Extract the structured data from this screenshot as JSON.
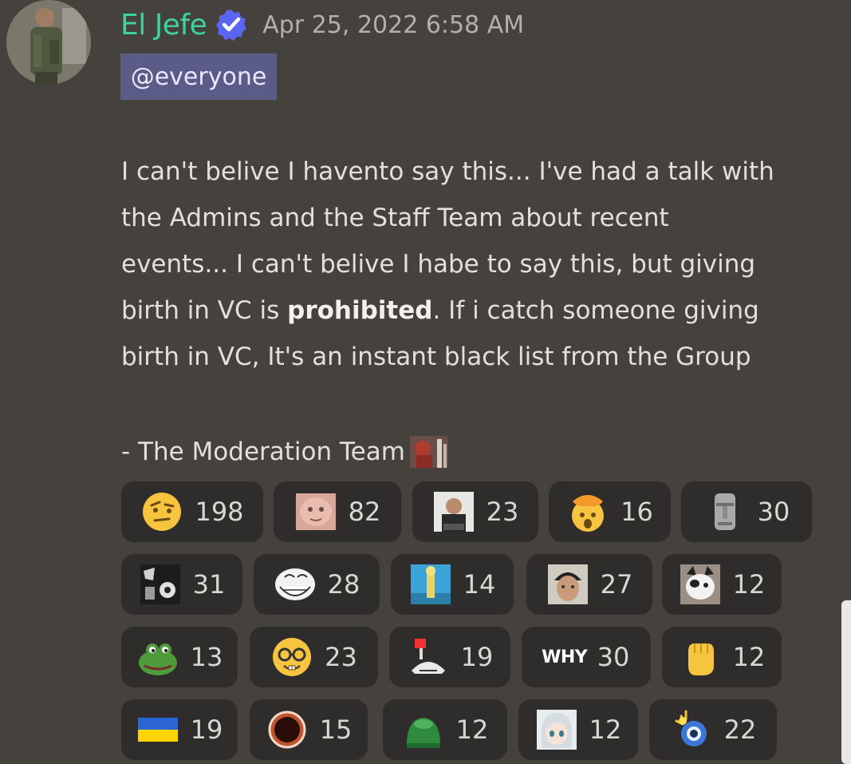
{
  "message": {
    "author": "El Jefe",
    "timestamp": "Apr 25, 2022 6:58 AM",
    "mention": "@everyone",
    "body_lines": [
      "I can't belive I havento say this... I've had a talk with",
      "the Admins and the Staff Team about recent",
      "events... I can't belive I habe to say this, but giving"
    ],
    "line4_before": "birth in VC is ",
    "line4_bold": "prohibited",
    "line4_after": ". If i catch someone giving",
    "line5": "birth in VC, It's an instant black list from the Group",
    "signature": "- The Moderation Team"
  },
  "icons": {
    "avatar": "avatar-soldier",
    "verified": "verified-check-icon",
    "signature_emoji": "custom-emoji-icon"
  },
  "colors": {
    "username": "#3fd29a",
    "mention_bg": "#5a5b86",
    "reaction_bg": "#2f2d2b",
    "background": "#45413d"
  },
  "reactions": [
    {
      "emoji": "raised-eyebrow-emoji",
      "count": "198"
    },
    {
      "emoji": "custom-face-emoji",
      "count": "82"
    },
    {
      "emoji": "custom-man-photo-emoji",
      "count": "23"
    },
    {
      "emoji": "exploding-head-emoji",
      "count": "16"
    },
    {
      "emoji": "moai-emoji",
      "count": "30"
    },
    {
      "emoji": "custom-bw-emoji",
      "count": "31"
    },
    {
      "emoji": "trollface-emoji",
      "count": "28"
    },
    {
      "emoji": "custom-cartoon-emoji",
      "count": "14"
    },
    {
      "emoji": "custom-beanie-emoji",
      "count": "27"
    },
    {
      "emoji": "custom-cat-emoji",
      "count": "12"
    },
    {
      "emoji": "pepe-frog-emoji",
      "count": "13"
    },
    {
      "emoji": "nerd-face-emoji",
      "count": "23"
    },
    {
      "emoji": "custom-phone-emoji",
      "count": "19"
    },
    {
      "emoji": "why-text-emoji",
      "label": "WHY",
      "count": "30"
    },
    {
      "emoji": "raised-fist-emoji",
      "count": "12"
    },
    {
      "emoji": "ukraine-flag-emoji",
      "count": "19"
    },
    {
      "emoji": "custom-ring-emoji",
      "count": "15"
    },
    {
      "emoji": "custom-green-blob-emoji",
      "count": "12"
    },
    {
      "emoji": "custom-anime-emoji",
      "count": "12"
    },
    {
      "emoji": "custom-bomb-emoji",
      "count": "22"
    }
  ]
}
